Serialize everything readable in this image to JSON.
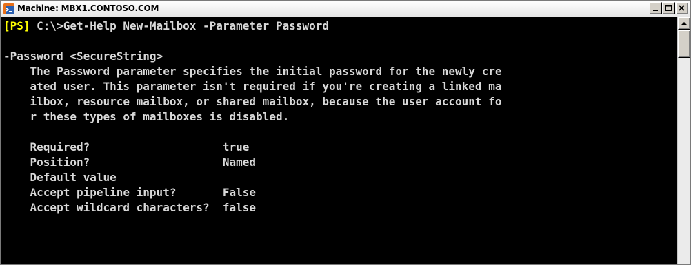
{
  "window": {
    "title": "Machine: MBX1.CONTOSO.COM",
    "controls": [
      "minimize",
      "maximize",
      "close"
    ]
  },
  "console": {
    "prompt_tag": "[PS]",
    "command": " C:\\>Get-Help New-Mailbox -Parameter Password",
    "lines": [
      "",
      "-Password <SecureString>",
      "    The Password parameter specifies the initial password for the newly cre",
      "    ated user. This parameter isn't required if you're creating a linked ma",
      "    ilbox, resource mailbox, or shared mailbox, because the user account fo",
      "    r these types of mailboxes is disabled.",
      "",
      "    Required?                    true",
      "    Position?                    Named",
      "    Default value",
      "    Accept pipeline input?       False",
      "    Accept wildcard characters?  false"
    ],
    "colors": {
      "background": "#000000",
      "text": "#d8d8d8",
      "prompt_tag": "#ffff00"
    }
  },
  "icons": {
    "title": "powershell-icon",
    "minimize": "minimize-icon",
    "maximize": "maximize-icon",
    "close": "close-icon",
    "scroll_up": "scroll-up-arrow-icon"
  }
}
